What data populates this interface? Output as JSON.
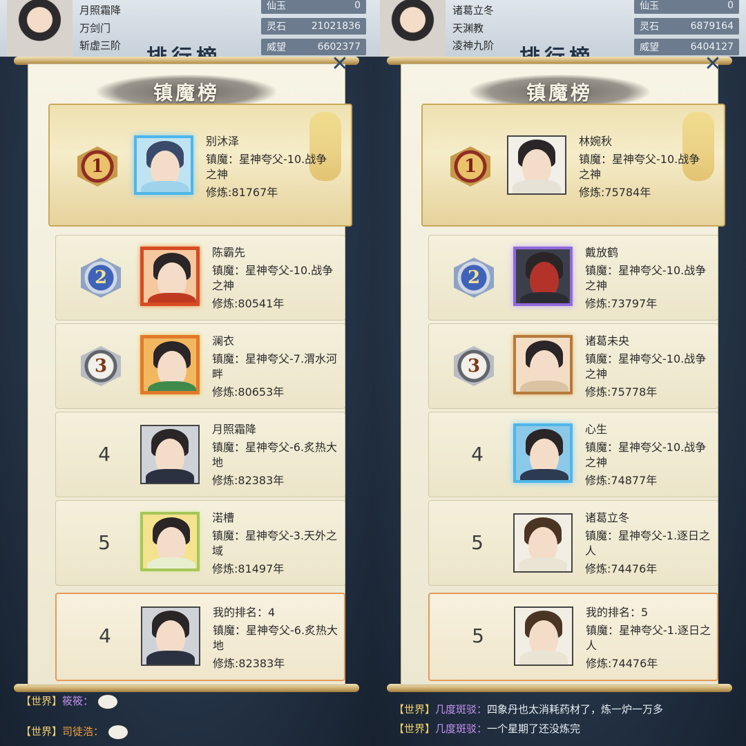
{
  "left": {
    "bg": {
      "name": "月照霜降",
      "sect": "万剑门",
      "realm": "斩虚三阶",
      "stats": [
        {
          "label": "仙玉",
          "value": "0"
        },
        {
          "label": "灵石",
          "value": "21021836"
        },
        {
          "label": "威望",
          "value": "6602377"
        }
      ],
      "title": "排行榜",
      "chat": [
        {
          "channel": "【世界】",
          "user": "筱筱：",
          "msg": ""
        },
        {
          "channel": "【世界】",
          "user": "司徒浩：",
          "msg": ""
        }
      ]
    },
    "panel": {
      "banner": "镇魔榜",
      "close": "✕",
      "entries": [
        {
          "rank": "1",
          "name": "别沐泽",
          "stage": "镇魔：星神夸父-10.战争之神",
          "cult": "修炼:81767年"
        },
        {
          "rank": "2",
          "name": "陈霸先",
          "stage": "镇魔：星神夸父-10.战争之神",
          "cult": "修炼:80541年"
        },
        {
          "rank": "3",
          "name": "澜衣",
          "stage": "镇魔：星神夸父-7.渭水河畔",
          "cult": "修炼:80653年"
        },
        {
          "rank": "4",
          "name": "月照霜降",
          "stage": "镇魔：星神夸父-6.炙热大地",
          "cult": "修炼:82383年"
        },
        {
          "rank": "5",
          "name": "渃槽",
          "stage": "镇魔：星神夸父-3.天外之域",
          "cult": "修炼:81497年"
        }
      ],
      "mine": {
        "rank": "4",
        "name": "我的排名：4",
        "stage": "镇魔：星神夸父-6.炙热大地",
        "cult": "修炼:82383年"
      }
    }
  },
  "right": {
    "bg": {
      "name": "诸葛立冬",
      "sect": "天渊教",
      "realm": "凌神九阶",
      "stats": [
        {
          "label": "仙玉",
          "value": "0"
        },
        {
          "label": "灵石",
          "value": "6879164"
        },
        {
          "label": "威望",
          "value": "6404127"
        }
      ],
      "title": "排行榜",
      "chat": [
        {
          "channel": "【世界】",
          "user": "几度斑驳：",
          "msg": "四象丹也太消耗药材了，炼一炉一万多"
        },
        {
          "channel": "【世界】",
          "user": "几度斑驳：",
          "msg": "一个星期了还没炼完"
        }
      ]
    },
    "panel": {
      "banner": "镇魔榜",
      "close": "✕",
      "entries": [
        {
          "rank": "1",
          "name": "林婉秋",
          "stage": "镇魔：星神夸父-10.战争之神",
          "cult": "修炼:75784年"
        },
        {
          "rank": "2",
          "name": "戴放鹤",
          "stage": "镇魔：星神夸父-10.战争之神",
          "cult": "修炼:73797年"
        },
        {
          "rank": "3",
          "name": "诸葛未央",
          "stage": "镇魔：星神夸父-10.战争之神",
          "cult": "修炼:75778年"
        },
        {
          "rank": "4",
          "name": "心生",
          "stage": "镇魔：星神夸父-10.战争之神",
          "cult": "修炼:74877年"
        },
        {
          "rank": "5",
          "name": "诸葛立冬",
          "stage": "镇魔：星神夸父-1.逐日之人",
          "cult": "修炼:74476年"
        }
      ],
      "mine": {
        "rank": "5",
        "name": "我的排名：5",
        "stage": "镇魔：星神夸父-1.逐日之人",
        "cult": "修炼:74476年"
      }
    }
  }
}
